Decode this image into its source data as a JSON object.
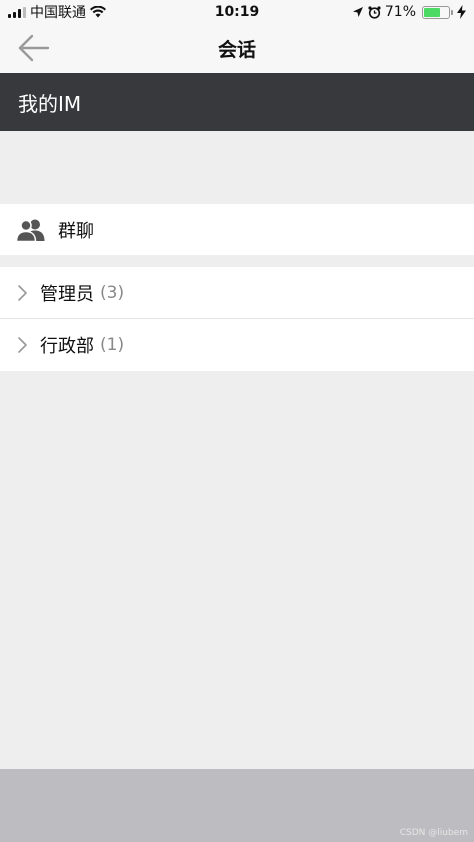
{
  "status_bar": {
    "carrier": "中国联通",
    "time": "10:19",
    "battery_percent_text": "71%",
    "battery_level": 0.71
  },
  "nav": {
    "title": "会话"
  },
  "header": {
    "title": "我的IM"
  },
  "group": {
    "label": "群聊"
  },
  "list": {
    "items": [
      {
        "name": "管理员",
        "count": "(3)"
      },
      {
        "name": "行政部",
        "count": "(1)"
      }
    ]
  },
  "watermark": "CSDN @liubem",
  "colors": {
    "header_bg": "#38393c",
    "battery_green": "#4cd964",
    "bottom_bar": "#bdbcc0"
  }
}
